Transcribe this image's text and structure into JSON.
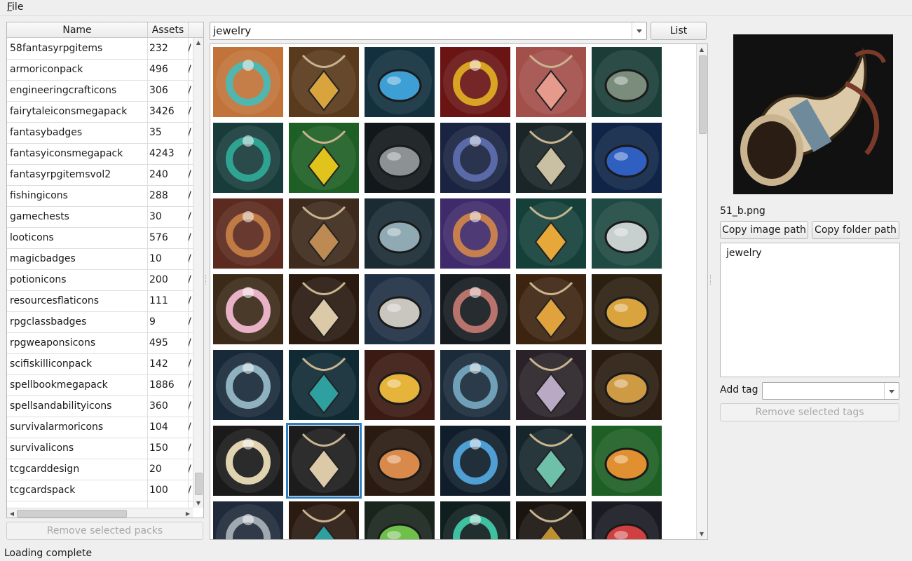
{
  "menu": {
    "file_prefix": "F",
    "file_rest": "ile"
  },
  "packs": {
    "headers": {
      "name": "Name",
      "assets": "Assets",
      "path": ""
    },
    "rows": [
      {
        "name": "58fantasyrpgitems",
        "assets": "232",
        "path": "/"
      },
      {
        "name": "armoriconpack",
        "assets": "496",
        "path": "/"
      },
      {
        "name": "engineeringcrafticons",
        "assets": "306",
        "path": "/"
      },
      {
        "name": "fairytaleiconsmegapack",
        "assets": "3426",
        "path": "/"
      },
      {
        "name": "fantasybadges",
        "assets": "35",
        "path": "/"
      },
      {
        "name": "fantasyiconsmegapack",
        "assets": "4243",
        "path": "/"
      },
      {
        "name": "fantasyrpgitemsvol2",
        "assets": "240",
        "path": "/"
      },
      {
        "name": "fishingicons",
        "assets": "288",
        "path": "/"
      },
      {
        "name": "gamechests",
        "assets": "30",
        "path": "/"
      },
      {
        "name": "looticons",
        "assets": "576",
        "path": "/"
      },
      {
        "name": "magicbadges",
        "assets": "10",
        "path": "/"
      },
      {
        "name": "potionicons",
        "assets": "200",
        "path": "/"
      },
      {
        "name": "resourcesflaticons",
        "assets": "111",
        "path": "/"
      },
      {
        "name": "rpgclassbadges",
        "assets": "9",
        "path": "/"
      },
      {
        "name": "rpgweaponsicons",
        "assets": "495",
        "path": "/"
      },
      {
        "name": "scifiskilliconpack",
        "assets": "142",
        "path": "/"
      },
      {
        "name": "spellbookmegapack",
        "assets": "1886",
        "path": "/"
      },
      {
        "name": "spellsandabilityicons",
        "assets": "360",
        "path": "/"
      },
      {
        "name": "survivalarmoricons",
        "assets": "104",
        "path": "/"
      },
      {
        "name": "survivalicons",
        "assets": "150",
        "path": "/"
      },
      {
        "name": "tcgcarddesign",
        "assets": "20",
        "path": "/"
      },
      {
        "name": "tcgcardspack",
        "assets": "100",
        "path": "/"
      }
    ],
    "remove_button": "Remove selected packs"
  },
  "search": {
    "value": "jewelry",
    "list_button": "List"
  },
  "grid": {
    "selected_index": 31,
    "icons": [
      {
        "name": "amulet-necklace-icon",
        "bg": "#c2733a",
        "fg": "#4fb7b0"
      },
      {
        "name": "gold-ring-icon",
        "bg": "#5a3a1c",
        "fg": "#d9a43d"
      },
      {
        "name": "blue-orb-icon",
        "bg": "#13303e",
        "fg": "#3d9fd4"
      },
      {
        "name": "ruby-pendant-icon",
        "bg": "#6a1414",
        "fg": "#d9a323"
      },
      {
        "name": "shell-necklace-icon",
        "bg": "#a3504a",
        "fg": "#e69a8c"
      },
      {
        "name": "studded-ring-icon",
        "bg": "#1b3d38",
        "fg": "#7a8c7c"
      },
      {
        "name": "crystal-ring-icon",
        "bg": "#183c3a",
        "fg": "#2fa391"
      },
      {
        "name": "emerald-ring-icon",
        "bg": "#1d5f24",
        "fg": "#e0c41b"
      },
      {
        "name": "red-gem-ring-icon",
        "bg": "#12171b",
        "fg": "#8c9294"
      },
      {
        "name": "blue-ring-icon",
        "bg": "#1a2340",
        "fg": "#5a6aa8"
      },
      {
        "name": "spiral-pendant-icon",
        "bg": "#1a2528",
        "fg": "#c9c0a3"
      },
      {
        "name": "triangle-pendant-icon",
        "bg": "#0f2447",
        "fg": "#2f5fc1"
      },
      {
        "name": "ruby-gold-ring-icon",
        "bg": "#5c2a1e",
        "fg": "#c07a44"
      },
      {
        "name": "engraved-ring-icon",
        "bg": "#3d2a1c",
        "fg": "#bd8a53"
      },
      {
        "name": "skull-ring-icon",
        "bg": "#1a2b33",
        "fg": "#8faab2"
      },
      {
        "name": "rune-pendant-icon",
        "bg": "#3f2b6b",
        "fg": "#c77f4e"
      },
      {
        "name": "leaf-pendant-icon",
        "bg": "#15403a",
        "fg": "#e6a838"
      },
      {
        "name": "winged-ring-icon",
        "bg": "#1f4a43",
        "fg": "#c7cfcf"
      },
      {
        "name": "flower-wreath-icon",
        "bg": "#3a2a17",
        "fg": "#e7b2c6"
      },
      {
        "name": "horn-necklace-icon",
        "bg": "#2a1a10",
        "fg": "#dcc9a8"
      },
      {
        "name": "pearl-ring-icon",
        "bg": "#1f2f44",
        "fg": "#c9c6c0"
      },
      {
        "name": "dice-pendant-icon",
        "bg": "#151b1f",
        "fg": "#b8746c"
      },
      {
        "name": "crescent-earring-icon",
        "bg": "#3d2410",
        "fg": "#e0a23d"
      },
      {
        "name": "plain-gold-ring-icon",
        "bg": "#2b1f10",
        "fg": "#d9a43d"
      },
      {
        "name": "square-gem-ring-icon",
        "bg": "#182a3a",
        "fg": "#8fb1c0"
      },
      {
        "name": "teal-drop-pendant-icon",
        "bg": "#0f2a33",
        "fg": "#2fa0a0"
      },
      {
        "name": "gold-crown-icon",
        "bg": "#3a1a12",
        "fg": "#e6b43a"
      },
      {
        "name": "serpent-ring-icon",
        "bg": "#1b2b3a",
        "fg": "#6fa0b8"
      },
      {
        "name": "silver-cross-pendant-icon",
        "bg": "#2a2228",
        "fg": "#b9a9c4"
      },
      {
        "name": "eye-ring-icon",
        "bg": "#2a1c10",
        "fg": "#cf9a44"
      },
      {
        "name": "fang-necklace-icon",
        "bg": "#1a1a1a",
        "fg": "#e0d3b0"
      },
      {
        "name": "horn-amulet-icon",
        "bg": "#1c1c1c",
        "fg": "#dcc9a8"
      },
      {
        "name": "claw-charm-icon",
        "bg": "#2a1a10",
        "fg": "#d98a4a"
      },
      {
        "name": "crystal-lantern-icon",
        "bg": "#0f1e2a",
        "fg": "#4f9fd4"
      },
      {
        "name": "feather-brooch-icon",
        "bg": "#16262b",
        "fg": "#6fc0a8"
      },
      {
        "name": "bell-charm-icon",
        "bg": "#1d5f24",
        "fg": "#e09030"
      },
      {
        "name": "silver-medallion-icon",
        "bg": "#1f2a3a",
        "fg": "#a0a8b0"
      },
      {
        "name": "teal-bead-necklace-icon",
        "bg": "#2a1a10",
        "fg": "#2fa0a0"
      },
      {
        "name": "green-gem-pendant-icon",
        "bg": "#18241c",
        "fg": "#6fc04a"
      },
      {
        "name": "chain-necklace-icon",
        "bg": "#0f1e1e",
        "fg": "#3fc0a0"
      },
      {
        "name": "gold-chain-icon",
        "bg": "#1a1410",
        "fg": "#c09030"
      },
      {
        "name": "mushroom-charm-icon",
        "bg": "#1a1a22",
        "fg": "#d04040"
      }
    ]
  },
  "preview": {
    "image_icon": "horn-amulet-icon",
    "filename": "51_b.png",
    "copy_image_path": "Copy image path",
    "copy_folder_path": "Copy folder path",
    "tags": [
      "jewelry"
    ],
    "add_tag_label": "Add tag",
    "add_tag_value": "",
    "remove_tags_button": "Remove selected tags"
  },
  "status": "Loading complete"
}
